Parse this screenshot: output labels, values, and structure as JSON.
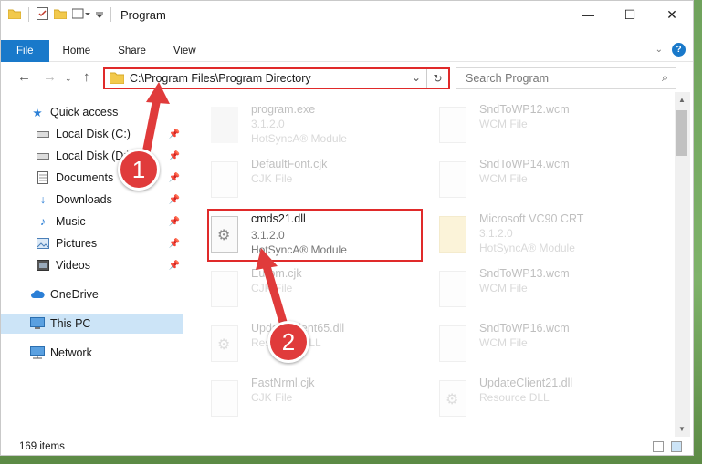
{
  "window": {
    "title": "Program",
    "controls": [
      "—",
      "☐",
      "✕"
    ]
  },
  "ribbon": {
    "tabs": [
      "File",
      "Home",
      "Share",
      "View"
    ],
    "help": "?"
  },
  "nav": {
    "address": "C:\\Program Files\\Program Directory",
    "search_placeholder": "Search Program"
  },
  "sidebar": {
    "items": [
      {
        "label": "Quick access",
        "icon": "star-icon"
      },
      {
        "label": "Local Disk (C:)",
        "icon": "drive-icon"
      },
      {
        "label": "Local Disk (D:)",
        "icon": "drive-icon"
      },
      {
        "label": "Documents",
        "icon": "documents-icon"
      },
      {
        "label": "Downloads",
        "icon": "downloads-icon"
      },
      {
        "label": "Music",
        "icon": "music-icon"
      },
      {
        "label": "Pictures",
        "icon": "pictures-icon"
      },
      {
        "label": "Videos",
        "icon": "videos-icon"
      },
      {
        "label": "OneDrive",
        "icon": "cloud-icon"
      },
      {
        "label": "This PC",
        "icon": "computer-icon"
      },
      {
        "label": "Network",
        "icon": "network-icon"
      }
    ]
  },
  "files": {
    "left": [
      {
        "name": "program.exe",
        "line2": "3.1.2.0",
        "line3": "HotSyncA® Module"
      },
      {
        "name": "DefaultFont.cjk",
        "line2": "CJK File"
      },
      {
        "name": "cmds21.dll",
        "line2": "3.1.2.0",
        "line3": "HotSyncA® Module"
      },
      {
        "name": "Eurom.cjk",
        "line2": "CJK File"
      },
      {
        "name": "UpdateClient65.dll",
        "line2": "Resource DLL"
      },
      {
        "name": "FastNrml.cjk",
        "line2": "CJK File"
      }
    ],
    "right": [
      {
        "name": "SndToWP12.wcm",
        "line2": "WCM File"
      },
      {
        "name": "SndToWP14.wcm",
        "line2": "WCM File"
      },
      {
        "name": "Microsoft VC90 CRT",
        "line2": "3.1.2.0",
        "line3": "HotSyncA® Module"
      },
      {
        "name": "SndToWP13.wcm",
        "line2": "WCM File"
      },
      {
        "name": "SndToWP16.wcm",
        "line2": "WCM File"
      },
      {
        "name": "UpdateClient21.dll",
        "line2": "Resource DLL"
      }
    ]
  },
  "status": {
    "count": "169 items"
  },
  "annotations": {
    "step1": "1",
    "step2": "2",
    "color": "#e03b3b"
  }
}
